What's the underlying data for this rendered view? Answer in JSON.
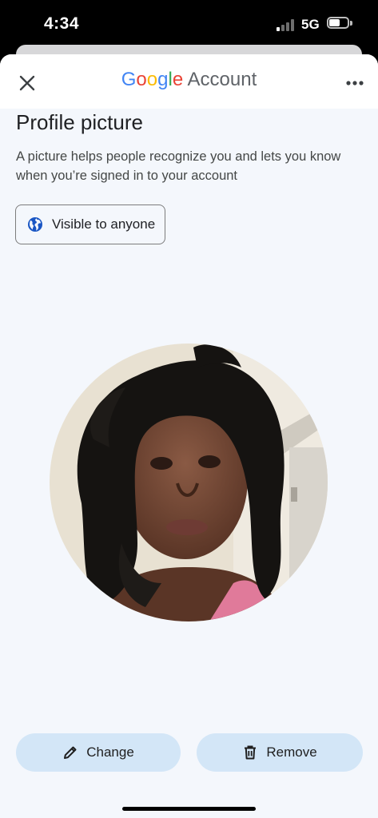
{
  "status_bar": {
    "time": "4:34",
    "network": "5G",
    "signal_bars_active": 1,
    "battery_level": 0.6
  },
  "header": {
    "brand_google": [
      "G",
      "o",
      "o",
      "g",
      "l",
      "e"
    ],
    "brand_google_colors": [
      "#4285F4",
      "#EA4335",
      "#FBBC05",
      "#4285F4",
      "#34A853",
      "#EA4335"
    ],
    "brand_suffix": "Account",
    "close_icon": "close-icon",
    "more_icon": "more-vert-icon"
  },
  "page": {
    "title": "Profile picture",
    "description": "A picture helps people recognize you and lets you know when you’re signed in to your account"
  },
  "visibility": {
    "icon": "globe-icon",
    "label": "Visible to anyone"
  },
  "avatar": {
    "icon": "profile-photo"
  },
  "actions": {
    "change_label": "Change",
    "change_icon": "pencil-icon",
    "remove_label": "Remove",
    "remove_icon": "trash-icon"
  }
}
